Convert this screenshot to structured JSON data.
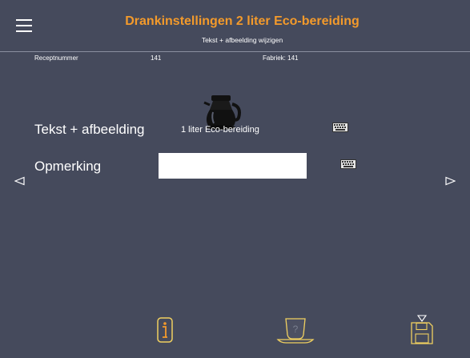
{
  "header": {
    "title": "Drankinstellingen 2 liter Eco-bereiding",
    "subtitle": "Tekst + afbeelding wijzigen"
  },
  "info": {
    "recipe_label": "Receptnummer",
    "recipe_number": "141",
    "factory": "Fabriek: 141"
  },
  "rows": {
    "text_image": {
      "label": "Tekst + afbeelding",
      "value": "1 liter Eco-bereiding"
    },
    "remark": {
      "label": "Opmerking",
      "value": "",
      "placeholder": ""
    }
  },
  "colors": {
    "background": "#454a5c",
    "title": "#f39a2b",
    "icon_outline": "#f0d060",
    "info_icon": "#f39a2b"
  },
  "icons": {
    "menu": "hamburger-icon",
    "carafe": "coffee-carafe-icon",
    "keyboard": "keyboard-icon",
    "prev": "triangle-left-icon",
    "next": "triangle-right-icon",
    "info": "info-icon",
    "cup": "cup-help-icon",
    "save": "save-floppy-icon"
  }
}
